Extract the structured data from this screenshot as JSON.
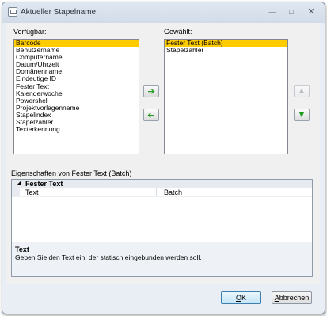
{
  "window": {
    "title": "Aktueller Stapelname"
  },
  "titlebar_icons": {
    "minimize": "minimize-icon",
    "maximize": "maximize-icon",
    "close": "close-icon"
  },
  "available": {
    "label": "Verfügbar:",
    "items": [
      "Barcode",
      "Benutzername",
      "Computername",
      "Datum/Uhrzeit",
      "Domänenname",
      "Eindeutige ID",
      "Fester Text",
      "Kalenderwoche",
      "Powershell",
      "Projektvorlagenname",
      "Stapelindex",
      "Stapelzähler",
      "Texterkennung"
    ],
    "selected_index": 0
  },
  "chosen": {
    "label": "Gewählt:",
    "items": [
      "Fester Text (Batch)",
      "Stapelzähler"
    ],
    "selected_index": 0
  },
  "move_buttons": {
    "add_icon": "arrow-right-icon",
    "remove_icon": "arrow-left-icon",
    "up_icon": "arrow-up-icon",
    "down_icon": "arrow-down-icon"
  },
  "properties": {
    "label": "Eigenschaften von Fester Text (Batch)",
    "category": "Fester Text",
    "rows": [
      {
        "key": "Text",
        "value": "Batch"
      }
    ],
    "help_title": "Text",
    "help_text": "Geben Sie den Text ein, der statisch eingebunden werden soll."
  },
  "buttons": {
    "ok_first": "O",
    "ok_rest": "K",
    "cancel_first": "A",
    "cancel_rest": "bbrechen"
  },
  "colors": {
    "selection": "#ffcc00",
    "arrow_green": "#1e9a1e"
  }
}
